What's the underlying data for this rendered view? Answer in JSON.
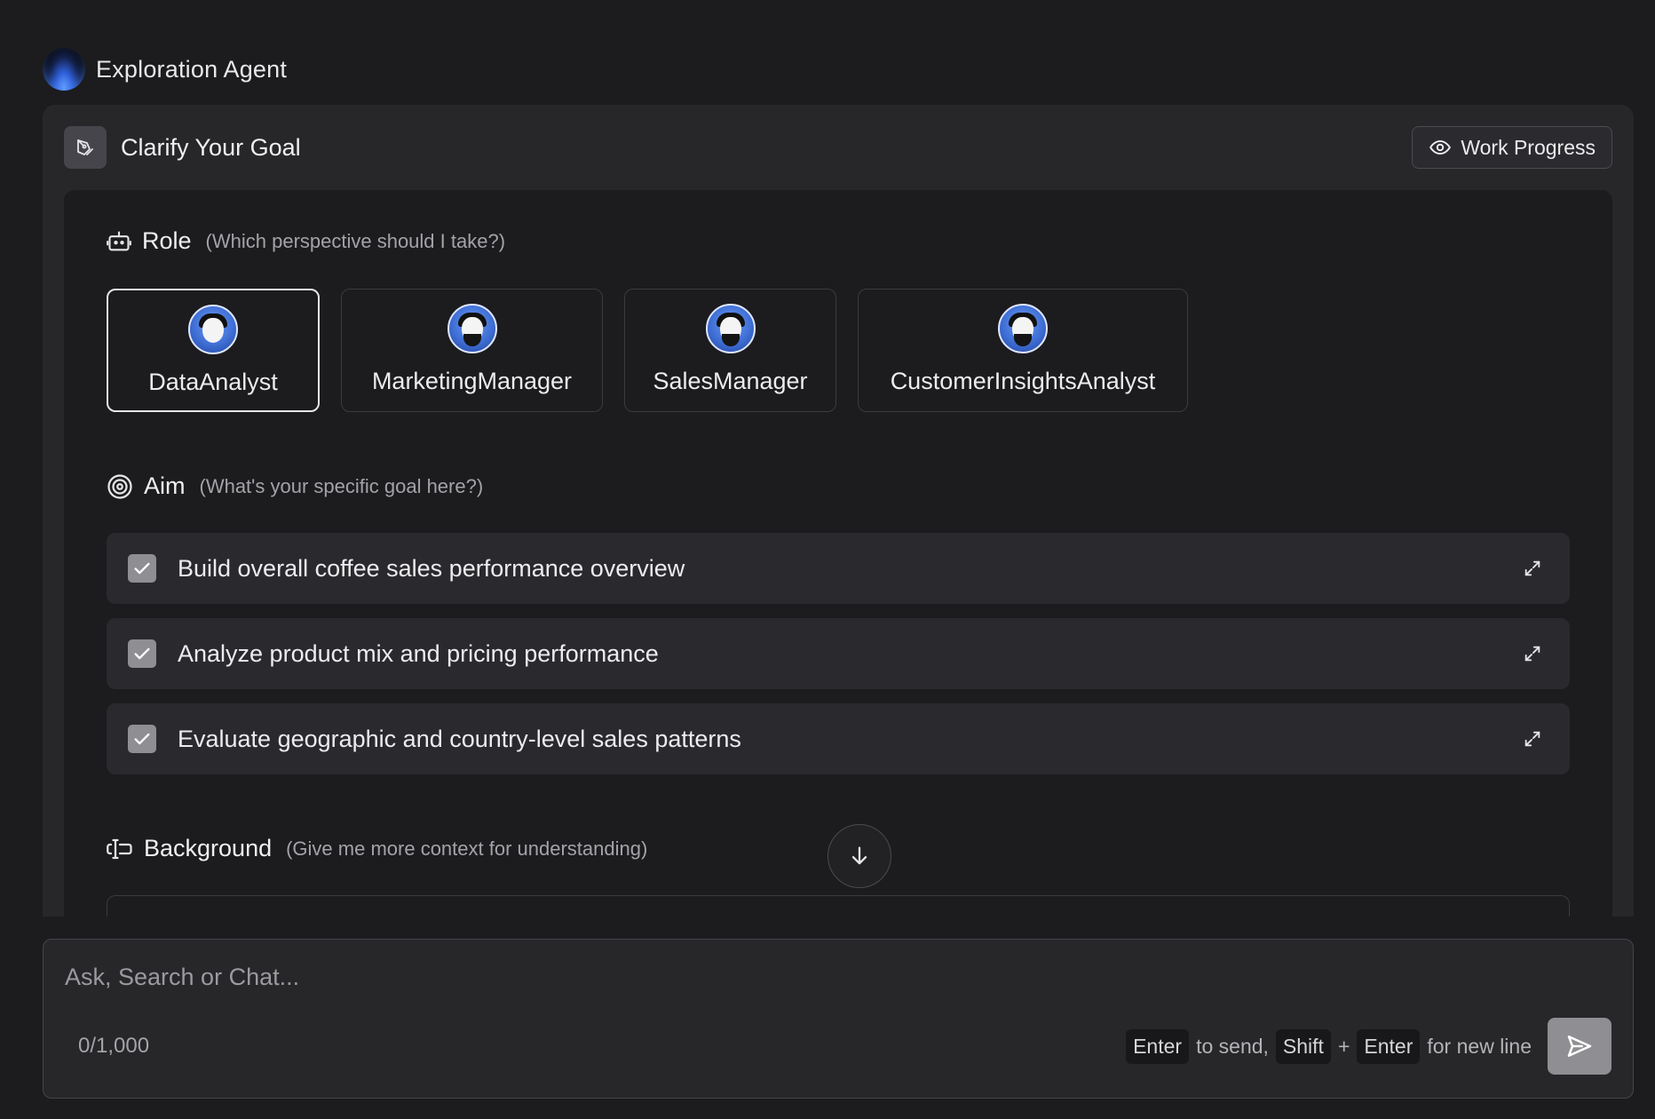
{
  "app": {
    "title": "Exploration Agent"
  },
  "panel": {
    "title": "Clarify Your Goal",
    "work_progress_label": "Work Progress"
  },
  "role": {
    "label": "Role",
    "hint": "(Which perspective should I take?)",
    "options": [
      {
        "name": "DataAnalyst",
        "selected": true
      },
      {
        "name": "MarketingManager",
        "selected": false
      },
      {
        "name": "SalesManager",
        "selected": false
      },
      {
        "name": "CustomerInsightsAnalyst",
        "selected": false
      }
    ]
  },
  "aim": {
    "label": "Aim",
    "hint": "(What's your specific goal here?)",
    "items": [
      {
        "text": "Build overall coffee sales performance overview",
        "checked": true
      },
      {
        "text": "Analyze product mix and pricing performance",
        "checked": true
      },
      {
        "text": "Evaluate geographic and country-level sales patterns",
        "checked": true
      }
    ]
  },
  "background": {
    "label": "Background",
    "hint": "(Give me more context for understanding)"
  },
  "composer": {
    "placeholder": "Ask, Search or Chat...",
    "char_count": "0/1,000",
    "key_enter": "Enter",
    "to_send": "to send,",
    "key_shift": "Shift",
    "plus": "+",
    "key_enter_2": "Enter",
    "for_new_line": "for new line"
  },
  "colors": {
    "page_bg": "#1c1c1f",
    "panel_bg": "#27272a",
    "avatar_blue": "#3f6fd6",
    "checkbox": "#8e8e93"
  }
}
